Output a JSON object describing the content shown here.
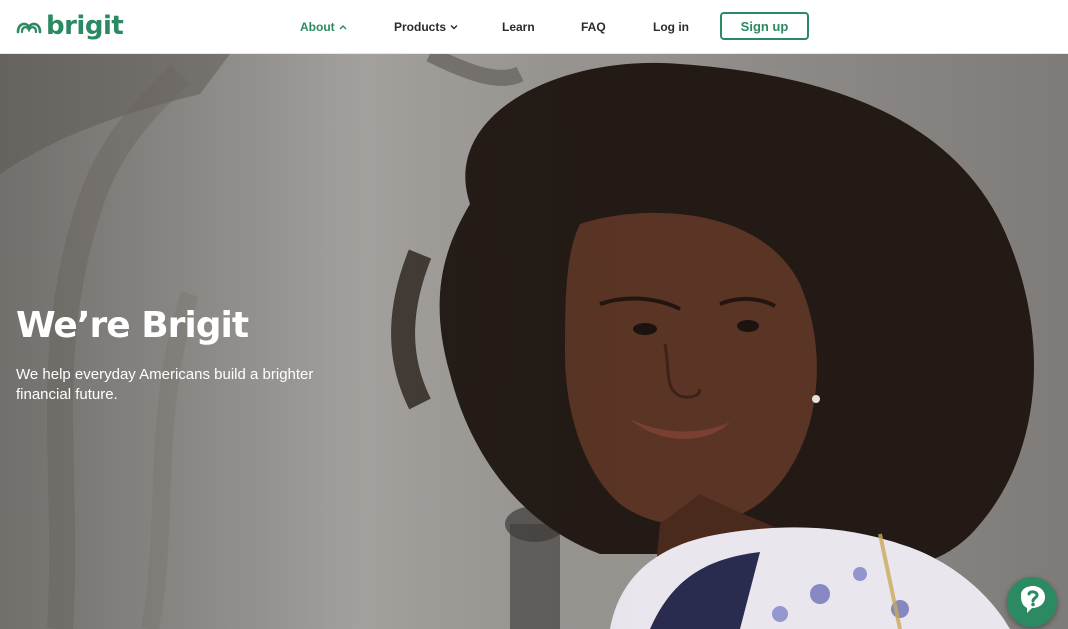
{
  "brand": {
    "name": "brigit",
    "color": "#2c8a63"
  },
  "nav": {
    "about": "About",
    "products": "Products",
    "learn": "Learn",
    "faq": "FAQ",
    "login": "Log in",
    "signup": "Sign up"
  },
  "hero": {
    "title": "We’re Brigit",
    "subtitle": "We help everyday Americans build a brighter financial future."
  },
  "help_button": {
    "icon": "question-chat-icon"
  }
}
